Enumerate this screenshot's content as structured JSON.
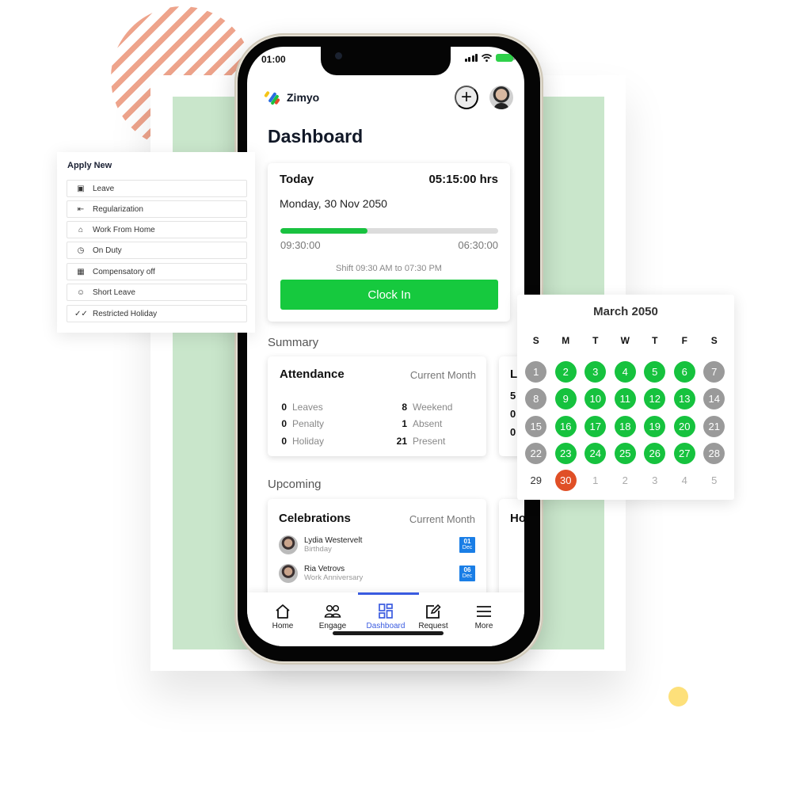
{
  "colors": {
    "accent_green": "#16c23e",
    "nav_active": "#3a5be0",
    "today_red": "#e04f26",
    "weekend_gray": "#9a9a9a",
    "badge_blue": "#1a7ee6"
  },
  "status_bar": {
    "time": "01:00"
  },
  "app": {
    "brand": "Zimyo",
    "add_icon": "plus-icon",
    "avatar": "user-avatar"
  },
  "dashboard": {
    "title": "Dashboard",
    "today": {
      "label": "Today",
      "hours": "05:15:00 hrs",
      "date": "Monday, 30 Nov 2050",
      "progress_percent": 40,
      "start": "09:30:00",
      "remaining": "06:30:00",
      "shift": "Shift 09:30 AM to 07:30 PM",
      "clock_in_label": "Clock In"
    },
    "summary_label": "Summary",
    "attendance": {
      "title": "Attendance",
      "period": "Current Month",
      "left": [
        {
          "num": "0",
          "label": "Leaves"
        },
        {
          "num": "0",
          "label": "Penalty"
        },
        {
          "num": "0",
          "label": "Holiday"
        }
      ],
      "right": [
        {
          "num": "8",
          "label": "Weekend"
        },
        {
          "num": "1",
          "label": "Absent"
        },
        {
          "num": "21",
          "label": "Present"
        }
      ]
    },
    "peek_card": {
      "title": "L",
      "values": [
        "5",
        "0",
        "0"
      ]
    },
    "upcoming_label": "Upcoming",
    "celebrations": {
      "title": "Celebrations",
      "period": "Current Month",
      "items": [
        {
          "name": "Lydia Westervelt",
          "type": "Birthday",
          "day": "01",
          "month": "Dec"
        },
        {
          "name": "Ria Vetrovs",
          "type": "Work Anniversary",
          "day": "06",
          "month": "Dec"
        }
      ]
    },
    "holiday_peek": {
      "title": "Ho"
    }
  },
  "bottom_nav": {
    "items": [
      {
        "label": "Home",
        "icon": "home-icon"
      },
      {
        "label": "Engage",
        "icon": "people-icon"
      },
      {
        "label": "Dashboard",
        "icon": "grid-icon",
        "active": true
      },
      {
        "label": "Request",
        "icon": "edit-icon"
      },
      {
        "label": "More",
        "icon": "menu-icon"
      }
    ]
  },
  "apply_new": {
    "title": "Apply New",
    "items": [
      {
        "label": "Leave",
        "icon": "calendar-icon"
      },
      {
        "label": "Regularization",
        "icon": "list-icon"
      },
      {
        "label": "Work From Home",
        "icon": "house-icon"
      },
      {
        "label": "On Duty",
        "icon": "clock-icon"
      },
      {
        "label": "Compensatory off",
        "icon": "calendar-grid-icon"
      },
      {
        "label": "Short Leave",
        "icon": "user-clock-icon"
      },
      {
        "label": "Restricted Holiday",
        "icon": "double-check-icon"
      }
    ]
  },
  "calendar": {
    "title": "March 2050",
    "weekdays": [
      "S",
      "M",
      "T",
      "W",
      "T",
      "F",
      "S"
    ],
    "days": [
      {
        "d": "1",
        "s": "off"
      },
      {
        "d": "2",
        "s": "work"
      },
      {
        "d": "3",
        "s": "work"
      },
      {
        "d": "4",
        "s": "work"
      },
      {
        "d": "5",
        "s": "work"
      },
      {
        "d": "6",
        "s": "work"
      },
      {
        "d": "7",
        "s": "off"
      },
      {
        "d": "8",
        "s": "off"
      },
      {
        "d": "9",
        "s": "work"
      },
      {
        "d": "10",
        "s": "work"
      },
      {
        "d": "11",
        "s": "work"
      },
      {
        "d": "12",
        "s": "work"
      },
      {
        "d": "13",
        "s": "work"
      },
      {
        "d": "14",
        "s": "off"
      },
      {
        "d": "15",
        "s": "off"
      },
      {
        "d": "16",
        "s": "work"
      },
      {
        "d": "17",
        "s": "work"
      },
      {
        "d": "18",
        "s": "work"
      },
      {
        "d": "19",
        "s": "work"
      },
      {
        "d": "20",
        "s": "work"
      },
      {
        "d": "21",
        "s": "off"
      },
      {
        "d": "22",
        "s": "off"
      },
      {
        "d": "23",
        "s": "work"
      },
      {
        "d": "24",
        "s": "work"
      },
      {
        "d": "25",
        "s": "work"
      },
      {
        "d": "26",
        "s": "work"
      },
      {
        "d": "27",
        "s": "work"
      },
      {
        "d": "28",
        "s": "off"
      },
      {
        "d": "29",
        "s": "plain"
      },
      {
        "d": "30",
        "s": "today"
      },
      {
        "d": "1",
        "s": "next"
      },
      {
        "d": "2",
        "s": "next"
      },
      {
        "d": "3",
        "s": "next"
      },
      {
        "d": "4",
        "s": "next"
      },
      {
        "d": "5",
        "s": "next"
      }
    ]
  }
}
